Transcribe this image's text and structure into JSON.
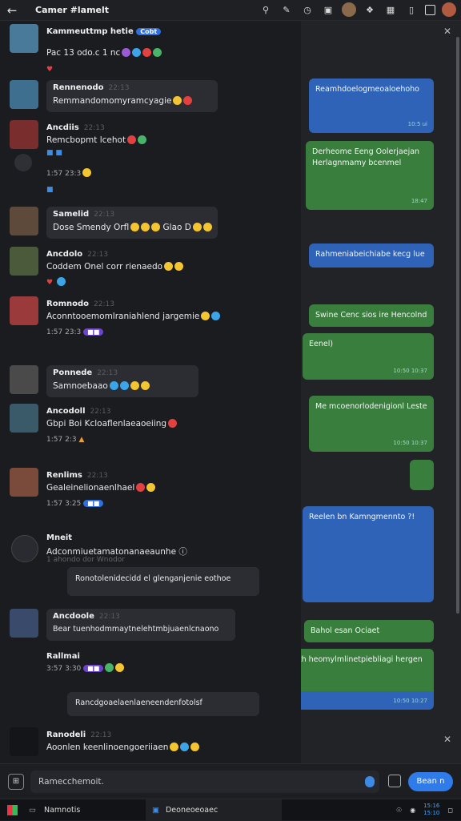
{
  "topbar": {
    "back_icon": "arrow-left-icon",
    "title": "Camer #lamelt"
  },
  "messages": [
    {
      "name": "Kammeuttmp hetie",
      "badge": "Cobt",
      "time": "",
      "text": "Pac 13 odo.c 1 nc",
      "avatar_color": "#4a7a9a"
    },
    {
      "name": "Rennenodo",
      "time": "22:13",
      "text": "Remmandomomyramcyagie",
      "avatar_color": "#3f6f8e"
    },
    {
      "name": "Ancdiis",
      "time": "22:13",
      "text": "Remcbopmt lcehot",
      "avatar_color": "#7a2d2d",
      "meta": "1:57  23:3"
    },
    {
      "name": "Samelid",
      "time": "22:13",
      "text": "Dose Smendy Orfl",
      "extra": "Glao D",
      "avatar_color": "#5e4a3a"
    },
    {
      "name": "Ancdolo",
      "time": "22:13",
      "text": "Coddem Onel corr rienaedo",
      "avatar_color": "#4a5a3a"
    },
    {
      "name": "Romnodo",
      "time": "22:13",
      "text": "Aconntooemomlraniahlend jargemie",
      "avatar_color": "#9a3a3a",
      "meta": "1:57  23:3"
    },
    {
      "name": "Ponnede",
      "time": "22:13",
      "text": "Samnoebaao",
      "avatar_color": "#4a4a4a"
    },
    {
      "name": "Ancodoll",
      "time": "22:13",
      "text": "Gbpi Boi Kcloaflenlaeaoeiing",
      "avatar_color": "#3a5a6a",
      "meta": "1:57  2:3"
    },
    {
      "name": "Renlims",
      "time": "22:13",
      "text": "Gealeinelionaenlhael",
      "avatar_color": "#7a4a3a",
      "meta": "1:57  3:25"
    },
    {
      "name": "Mneit",
      "time": "",
      "text": "Adconmiuetamatonanaeaunhe",
      "sub": "1 ahondo dor Wnodor",
      "reply": "Ronotolenidecidd el glenganjenie eothoe",
      "avatar_color": "#2a2b30"
    },
    {
      "name": "Ancdoole",
      "time": "22:13",
      "text": "Bear tuenhodmmaytnelehtmbjuaenlcnaono",
      "avatar_color": "#3a4a6a"
    },
    {
      "name": "Rallmai",
      "time": "",
      "text": "",
      "meta": "3:57  3:30",
      "reply": "Rancdgoaelaenlaeneendenfotolsf"
    },
    {
      "name": "Ranodeli",
      "time": "22:13",
      "text": "Aoonlen keenlinoengoeriiaen",
      "avatar_color": "#141518"
    }
  ],
  "right_bubbles": [
    {
      "text": "Reamhdoelogmeoaloehoho",
      "color": "blue",
      "ts": "10:5 ui"
    },
    {
      "text": "Derheome Eeng Oolerjaejan Herlagnmamy bcenmel",
      "color": "green",
      "ts": "18:47"
    },
    {
      "text": "Rahmeniabeichiabe kecg lue",
      "color": "blue",
      "ts": ""
    },
    {
      "text": "Swine Cenc sios ire Hencolnd",
      "color": "green",
      "ts": ""
    },
    {
      "text": "Eenel)",
      "color": "green",
      "ts": "10:50 10:37"
    },
    {
      "text": "Me mcoenorlodenigionl Leste",
      "color": "green",
      "ts": "10:50 10:37"
    },
    {
      "text": "Reelen bn Kamngmennto ?!",
      "color": "blue",
      "ts": ""
    },
    {
      "text": "Bahol esan Ociaet",
      "color": "green",
      "ts": ""
    },
    {
      "text": "Minth heomylmlinetpiebliagi hergen ?!",
      "color": "green",
      "ts": "10:50 10:27"
    }
  ],
  "composer": {
    "placeholder": "Ramecchemoit.",
    "send_label": "Bean n"
  },
  "taskbar": {
    "app1": "Namnotis",
    "app2": "Deoneoeoaec",
    "clock_line1": "15:16",
    "clock_line2": "15:10"
  }
}
